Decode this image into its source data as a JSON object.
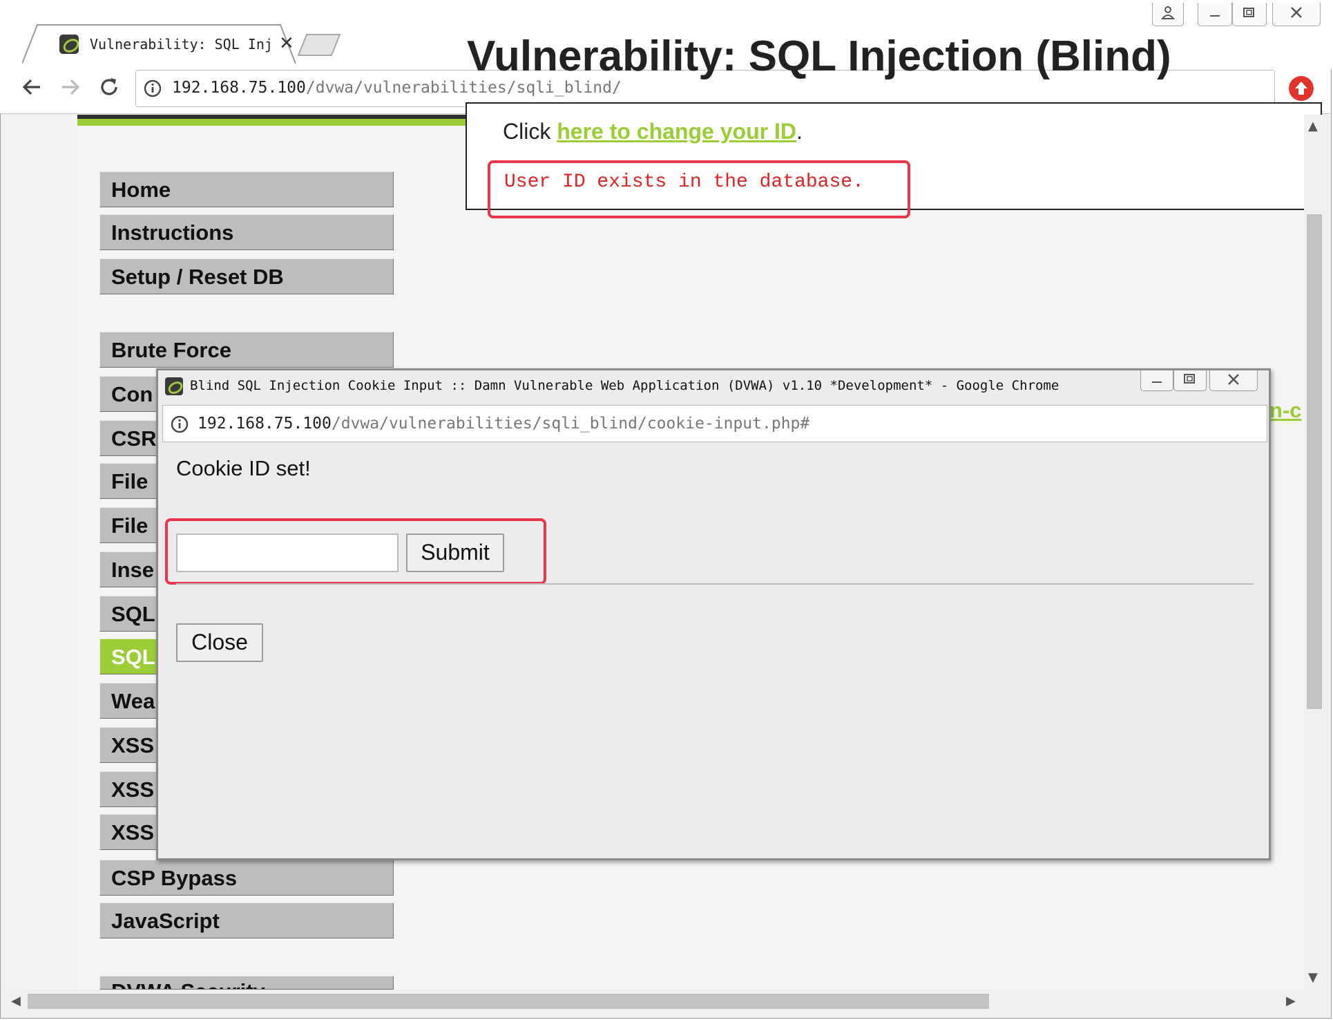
{
  "browser": {
    "window_controls": {
      "user": "👤",
      "minimize": "—",
      "maximize": "□",
      "close": "✕"
    },
    "tab": {
      "title": "Vulnerability: SQL Inj",
      "close": "✕"
    },
    "address": {
      "host": "192.168.75.100",
      "path": "/dvwa/vulnerabilities/sqli_blind/"
    },
    "icons": [
      "back-icon",
      "forward-icon",
      "reload-icon",
      "info-icon",
      "star-icon",
      "extension-icon"
    ]
  },
  "sidebar": {
    "items": [
      {
        "label": "Home"
      },
      {
        "label": "Instructions"
      },
      {
        "label": "Setup / Reset DB"
      },
      {
        "label": "Brute Force"
      },
      {
        "label": "Con"
      },
      {
        "label": "CSR"
      },
      {
        "label": "File"
      },
      {
        "label": "File"
      },
      {
        "label": "Inse"
      },
      {
        "label": "SQL"
      },
      {
        "label": "SQL",
        "active": true
      },
      {
        "label": "Wea"
      },
      {
        "label": "XSS"
      },
      {
        "label": "XSS"
      },
      {
        "label": "XSS"
      },
      {
        "label": "CSP Bypass"
      },
      {
        "label": "JavaScript"
      },
      {
        "label": "DVWA Security"
      }
    ]
  },
  "main": {
    "title": "Vulnerability: SQL Injection (Blind)",
    "click_prefix": "Click ",
    "click_link": "here to change your ID",
    "click_suffix": ".",
    "result": "User ID exists in the database.",
    "edge_link_fragment": "n-c"
  },
  "popup": {
    "title": "Blind SQL Injection Cookie Input :: Damn Vulnerable Web Application (DVWA) v1.10 *Development* - Google Chrome",
    "controls": {
      "minimize": "—",
      "maximize": "□",
      "close": "✕"
    },
    "address": {
      "host": "192.168.75.100",
      "path": "/dvwa/vulnerabilities/sqli_blind/cookie-input.php#"
    },
    "message": "Cookie ID set!",
    "input": {
      "value": "",
      "placeholder": ""
    },
    "submit_label": "Submit",
    "close_label": "Close"
  },
  "colors": {
    "accent_green": "#9bcd37",
    "highlight_red": "#e8364d",
    "result_red": "#e02424"
  }
}
